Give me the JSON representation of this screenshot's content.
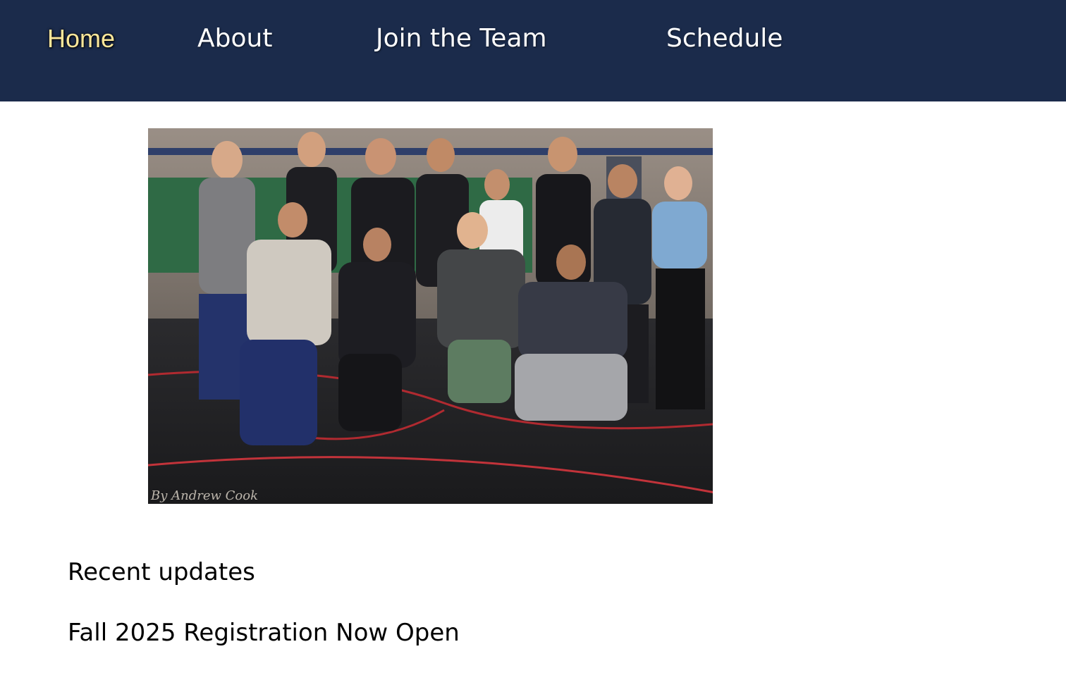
{
  "nav": {
    "items": [
      {
        "label": "Home",
        "active": true
      },
      {
        "label": "About",
        "active": false
      },
      {
        "label": "Join the Team",
        "active": false
      },
      {
        "label": "Schedule",
        "active": false
      }
    ]
  },
  "hero": {
    "credit": "By Andrew Cook"
  },
  "updates": {
    "heading": "Recent updates",
    "items": [
      {
        "title": "Fall 2025 Registration Now Open"
      }
    ]
  },
  "colors": {
    "nav_background": "#1b2b4b",
    "nav_active": "#fbe79a",
    "nav_text": "#ffffff",
    "page_background": "#ffffff"
  }
}
